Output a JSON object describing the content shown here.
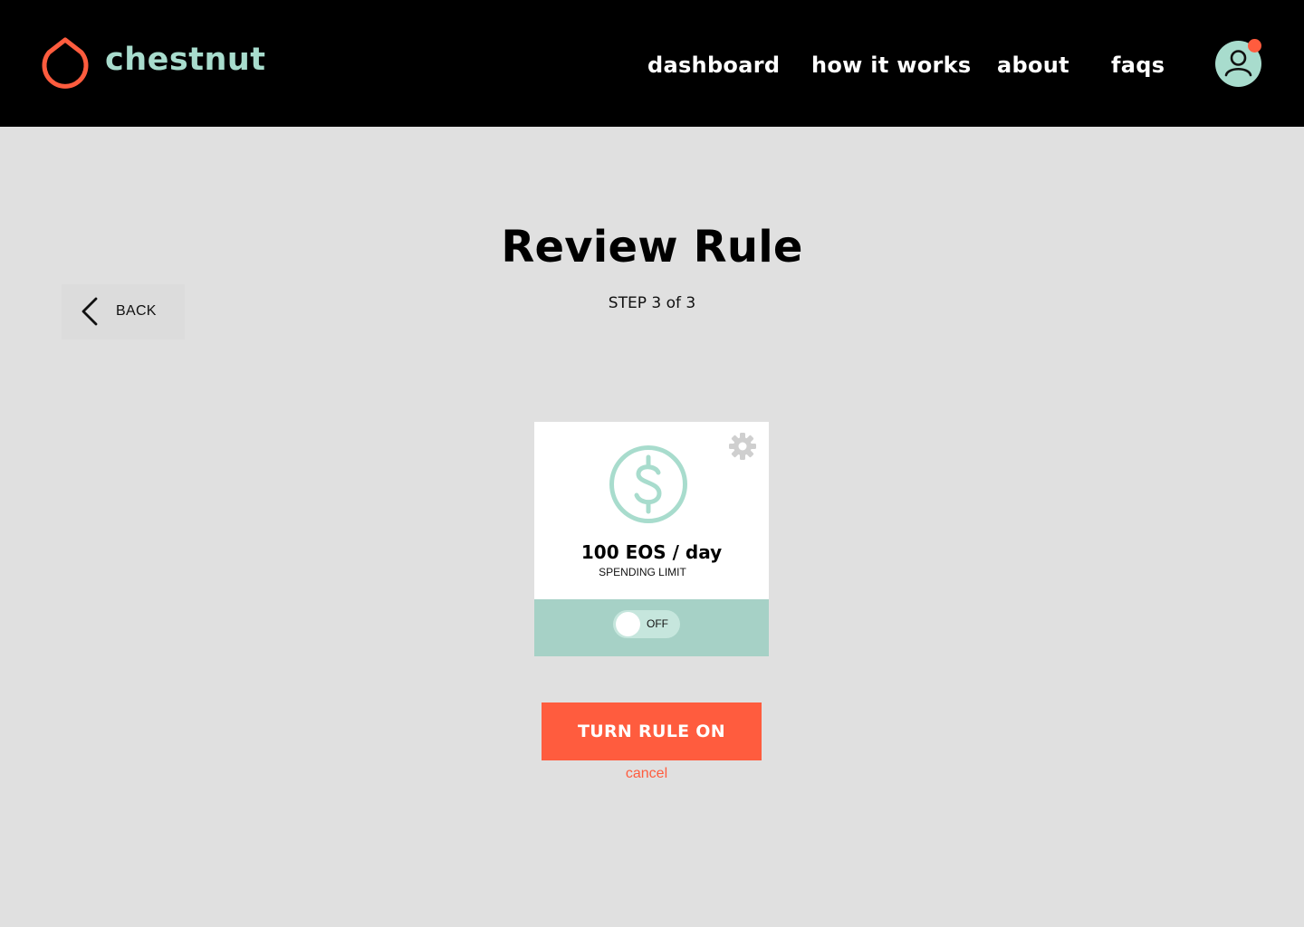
{
  "brand": {
    "name": "chestnut",
    "icon": "chestnut-logo-icon"
  },
  "nav": {
    "dashboard": "dashboard",
    "how_it_works": "how it works",
    "about": "about",
    "faqs": "faqs"
  },
  "user": {
    "icon": "user-avatar-icon",
    "has_notification": true
  },
  "page": {
    "title": "Review Rule",
    "step": "STEP 3 of 3"
  },
  "back": {
    "label": "BACK",
    "icon": "chevron-left-icon"
  },
  "rule_card": {
    "icon": "dollar-circle-icon",
    "settings_icon": "gear-icon",
    "amount": "100 EOS / day",
    "type": "SPENDING LIMIT",
    "toggle_state": "OFF"
  },
  "actions": {
    "primary": "TURN RULE ON",
    "cancel": "cancel"
  },
  "colors": {
    "accent": "#ff5c3e",
    "mint": "#a8dccd",
    "card_footer": "#a6d1c6",
    "background": "#e0e0e0",
    "header": "#000000"
  }
}
